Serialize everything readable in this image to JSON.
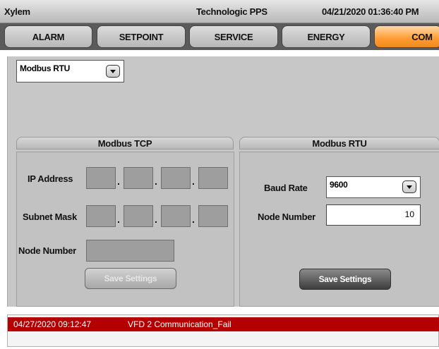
{
  "titlebar": {
    "brand": "Xylem",
    "product": "Technologic PPS",
    "datetime": "04/21/2020 01:36:40 PM"
  },
  "tabs": [
    {
      "label": "ALARM",
      "active": false
    },
    {
      "label": "SETPOINT",
      "active": false
    },
    {
      "label": "SERVICE",
      "active": false
    },
    {
      "label": "ENERGY",
      "active": false
    },
    {
      "label": "COM",
      "active": true
    }
  ],
  "protocol_select": {
    "value": "Modbus RTU",
    "icon": "chevron-down-icon"
  },
  "modbus_tcp": {
    "title": "Modbus TCP",
    "ip_label": "IP Address",
    "subnet_label": "Subnet Mask",
    "node_label": "Node Number",
    "save_label": "Save Settings",
    "separator": "."
  },
  "modbus_rtu": {
    "title": "Modbus RTU",
    "baud_label": "Baud Rate",
    "baud_value": "9600",
    "node_label": "Node Number",
    "node_value": "10",
    "save_label": "Save Settings"
  },
  "alarm": {
    "timestamp": "04/27/2020 09:12:47",
    "message": "VFD 2 Communication_Fail"
  },
  "colors": {
    "active_tab": "#ff9b32",
    "alarm_bg": "#b40000"
  }
}
